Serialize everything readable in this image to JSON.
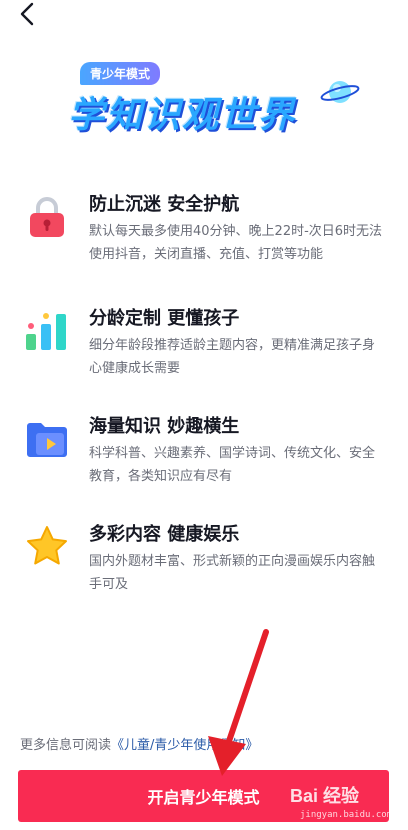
{
  "header": {
    "back_icon": "chevron-left-icon"
  },
  "banner": {
    "tag": "青少年模式",
    "title": "学知识观世界",
    "colors": {
      "title": "#2aa7ff",
      "shadow": "#1f4fd8",
      "tag": "#6f8dff"
    }
  },
  "features": [
    {
      "icon": "lock-icon",
      "title": "防止沉迷 安全护航",
      "desc": "默认每天最多使用40分钟、晚上22时-次日6时无法使用抖音，关闭直播、充值、打赏等功能"
    },
    {
      "icon": "bar-chart-icon",
      "title": "分龄定制 更懂孩子",
      "desc": "细分年龄段推荐适龄主题内容，更精准满足孩子身心健康成长需要"
    },
    {
      "icon": "video-folder-icon",
      "title": "海量知识 妙趣横生",
      "desc": "科学科普、兴趣素养、国学诗词、传统文化、安全教育，各类知识应有尽有"
    },
    {
      "icon": "star-icon",
      "title": "多彩内容 健康娱乐",
      "desc": "国内外题材丰富、形式新颖的正向漫画娱乐内容触手可及"
    }
  ],
  "notice": {
    "prefix": "更多信息可阅读",
    "link": "《儿童/青少年使用须知》"
  },
  "cta": {
    "label": "开启青少年模式",
    "color": "#f92b52"
  },
  "watermark": {
    "brand": "Bai 经验",
    "url": "jingyan.baidu.com"
  }
}
